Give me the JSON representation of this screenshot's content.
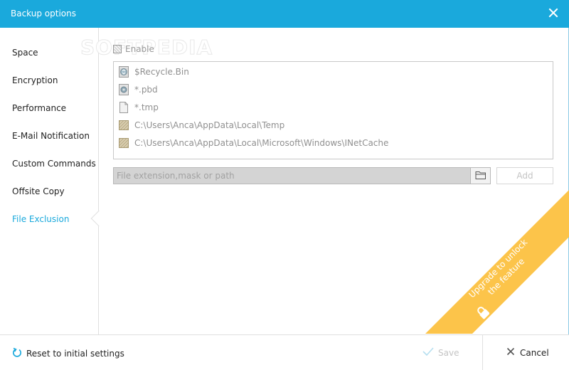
{
  "window": {
    "title": "Backup options",
    "close_icon": "close-icon"
  },
  "watermark": "SOFTPEDIA",
  "sidebar": {
    "items": [
      {
        "label": "Space",
        "active": false
      },
      {
        "label": "Encryption",
        "active": false
      },
      {
        "label": "Performance",
        "active": false
      },
      {
        "label": "E-Mail Notification",
        "active": false
      },
      {
        "label": "Custom Commands",
        "active": false
      },
      {
        "label": "Offsite Copy",
        "active": false
      },
      {
        "label": "File Exclusion",
        "active": true
      }
    ]
  },
  "exclusion": {
    "enable_label": "Enable",
    "enable_checked": false,
    "items": [
      {
        "text": "$Recycle.Bin",
        "icon": "recycle-bin-icon"
      },
      {
        "text": "*.pbd",
        "icon": "file-type-icon"
      },
      {
        "text": "*.tmp",
        "icon": "file-icon"
      },
      {
        "text": "C:\\Users\\Anca\\AppData\\Local\\Temp",
        "icon": "folder-icon"
      },
      {
        "text": "C:\\Users\\Anca\\AppData\\Local\\Microsoft\\Windows\\INetCache",
        "icon": "folder-icon"
      }
    ],
    "input_placeholder": "File extension,mask or path",
    "browse_icon": "folder-open-icon",
    "add_label": "Add"
  },
  "upgrade_ribbon": {
    "text_line1": "Upgrade to unlock",
    "text_line2": "the feature",
    "icon": "lock-icon",
    "color": "#fcc44a"
  },
  "footer": {
    "reset_label": "Reset to initial settings",
    "save_label": "Save",
    "cancel_label": "Cancel"
  },
  "colors": {
    "accent": "#1aa9dc",
    "disabled_text": "#c4c4c4",
    "ribbon": "#fcc44a"
  }
}
